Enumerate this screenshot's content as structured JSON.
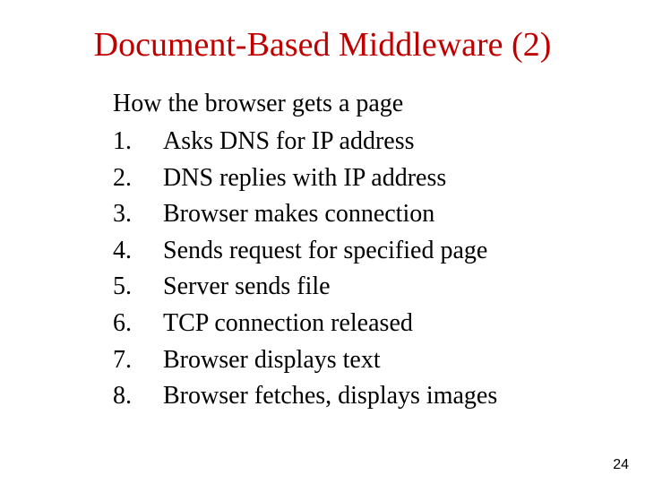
{
  "slide": {
    "title": "Document-Based Middleware (2)",
    "intro": "How the browser gets a page",
    "steps": [
      {
        "num": "1.",
        "text": "Asks DNS for IP address"
      },
      {
        "num": "2.",
        "text": "DNS replies with IP address"
      },
      {
        "num": "3.",
        "text": "Browser makes connection"
      },
      {
        "num": "4.",
        "text": "Sends request for specified page"
      },
      {
        "num": "5.",
        "text": "Server sends file"
      },
      {
        "num": "6.",
        "text": "TCP connection released"
      },
      {
        "num": "7.",
        "text": "Browser displays text"
      },
      {
        "num": "8.",
        "text": "Browser fetches, displays images"
      }
    ],
    "page_number": "24"
  }
}
